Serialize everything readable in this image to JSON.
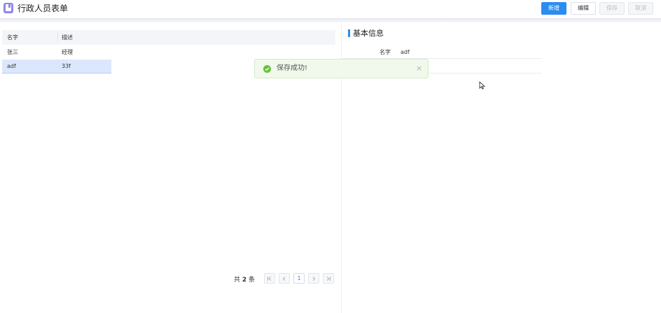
{
  "app": {
    "title": "行政人员表单"
  },
  "toolbar": {
    "new_label": "新增",
    "edit_label": "编辑",
    "save_label": "保存",
    "cancel_label": "取消"
  },
  "table": {
    "columns": [
      "名字",
      "描述"
    ],
    "rows": [
      {
        "name": "张三",
        "desc": "经理",
        "selected": false
      },
      {
        "name": "adf",
        "desc": "33f",
        "selected": true
      }
    ]
  },
  "pagination": {
    "total_prefix": "共",
    "total_count": "2",
    "total_suffix": "条",
    "current_page": "1"
  },
  "detail": {
    "section_title": "基本信息",
    "fields": [
      {
        "label": "名字",
        "value": "adf"
      }
    ]
  },
  "toast": {
    "message": "保存成功!",
    "close": "×"
  },
  "colors": {
    "primary": "#2d8cf0",
    "success": "#67c23a",
    "selected_row": "#dbe7fc"
  }
}
